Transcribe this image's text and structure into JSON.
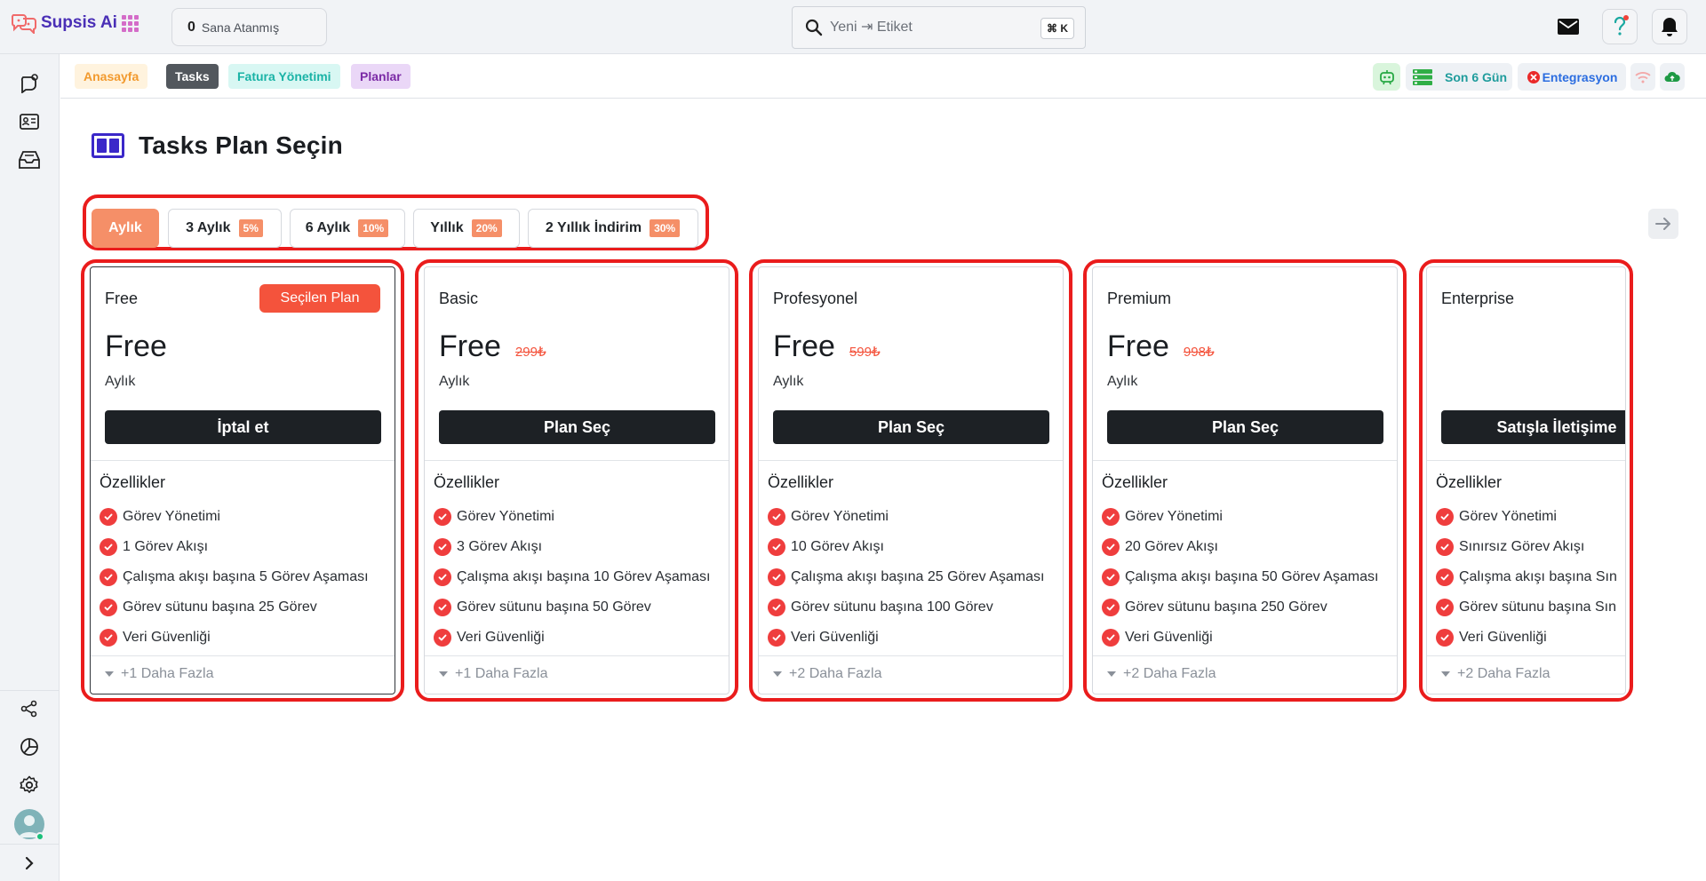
{
  "app": {
    "name": "Supsis Ai"
  },
  "topbar": {
    "assigned_count": "0",
    "assigned_label": "Sana Atanmış",
    "search_placeholder": "Yeni ⇥ Etiket",
    "search_shortcut": "⌘ K",
    "icons": [
      "mail-icon",
      "help-icon",
      "bell-icon"
    ]
  },
  "sidebar": {
    "top_icons": [
      "chat-icon",
      "contact-card-icon",
      "inbox-icon"
    ],
    "bottom_icons": [
      "share-icon",
      "chart-pie-icon",
      "settings-icon",
      "avatar",
      "expand-icon"
    ]
  },
  "tabs": [
    {
      "label": "Anasayfa",
      "bg": "#fff3de",
      "color": "#f29a2e"
    },
    {
      "label": "Tasks",
      "bg": "#52575d",
      "color": "#ffffff"
    },
    {
      "label": "Fatura Yönetimi",
      "bg": "#d8f7f3",
      "color": "#1ab3a6"
    },
    {
      "label": "Planlar",
      "bg": "#ead7f7",
      "color": "#7b2aa6"
    }
  ],
  "status": {
    "period_label": "Son 6 Gün",
    "integration_label": "Entegrasyon"
  },
  "page": {
    "title": "Tasks Plan Seçin"
  },
  "periods": [
    {
      "label": "Aylık",
      "discount": "",
      "active": true
    },
    {
      "label": "3 Aylık",
      "discount": "5%",
      "active": false
    },
    {
      "label": "6 Aylık",
      "discount": "10%",
      "active": false
    },
    {
      "label": "Yıllık",
      "discount": "20%",
      "active": false
    },
    {
      "label": "2 Yıllık İndirim",
      "discount": "30%",
      "active": false
    }
  ],
  "features_title": "Özellikler",
  "plans": [
    {
      "name": "Free",
      "badge": "Seçilen Plan",
      "price": "Free",
      "old_price": "",
      "period": "Aylık",
      "cta": "İptal et",
      "more": "+1 Daha Fazla",
      "features": [
        "Görev Yönetimi",
        "1 Görev Akışı",
        "Çalışma akışı başına 5 Görev Aşaması",
        "Görev sütunu başına 25 Görev",
        "Veri Güvenliği"
      ]
    },
    {
      "name": "Basic",
      "badge": "",
      "price": "Free",
      "old_price": "299₺",
      "period": "Aylık",
      "cta": "Plan Seç",
      "more": "+1 Daha Fazla",
      "features": [
        "Görev Yönetimi",
        "3 Görev Akışı",
        "Çalışma akışı başına 10 Görev Aşaması",
        "Görev sütunu başına 50 Görev",
        "Veri Güvenliği"
      ]
    },
    {
      "name": "Profesyonel",
      "badge": "",
      "price": "Free",
      "old_price": "599₺",
      "period": "Aylık",
      "cta": "Plan Seç",
      "more": "+2 Daha Fazla",
      "features": [
        "Görev Yönetimi",
        "10 Görev Akışı",
        "Çalışma akışı başına 25 Görev Aşaması",
        "Görev sütunu başına 100 Görev",
        "Veri Güvenliği"
      ]
    },
    {
      "name": "Premium",
      "badge": "",
      "price": "Free",
      "old_price": "998₺",
      "period": "Aylık",
      "cta": "Plan Seç",
      "more": "+2 Daha Fazla",
      "features": [
        "Görev Yönetimi",
        "20 Görev Akışı",
        "Çalışma akışı başına 50 Görev Aşaması",
        "Görev sütunu başına 250 Görev",
        "Veri Güvenliği"
      ]
    },
    {
      "name": "Enterprise",
      "badge": "",
      "price": "",
      "old_price": "",
      "period": "",
      "cta": "Satışla İletişime",
      "more": "+2 Daha Fazla",
      "features": [
        "Görev Yönetimi",
        "Sınırsız Görev Akışı",
        "Çalışma akışı başına Sın",
        "Görev sütunu başına Sın",
        "Veri Güvenliği"
      ]
    }
  ]
}
